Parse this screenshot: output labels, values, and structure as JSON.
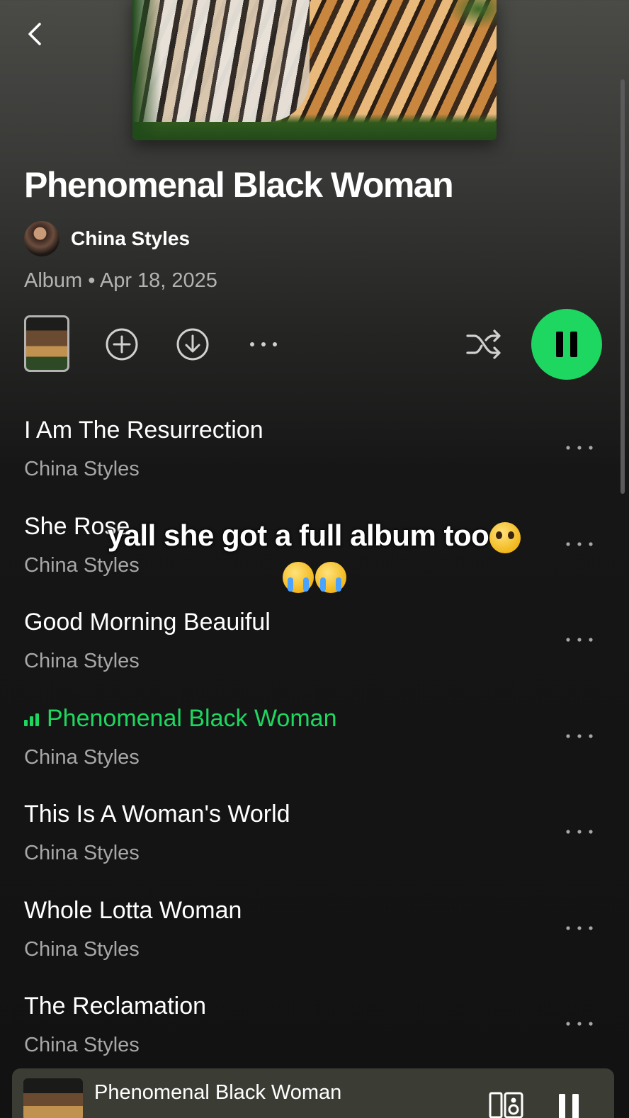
{
  "header": {
    "album_title": "Phenomenal Black Woman",
    "artist": "China Styles",
    "meta": "Album • Apr 18, 2025"
  },
  "colors": {
    "accent": "#1ed760",
    "background": "#121212",
    "secondary_text": "#b3b3b3"
  },
  "icons": {
    "back": "chevron-left-icon",
    "add": "plus-circle-icon",
    "download": "download-icon",
    "more": "more-horizontal-icon",
    "shuffle": "shuffle-icon",
    "pause": "pause-icon",
    "devices": "connect-device-icon"
  },
  "tracks": [
    {
      "title": "I Am The Resurrection",
      "artist": "China Styles"
    },
    {
      "title": "She Rose",
      "artist": "China Styles"
    },
    {
      "title": "Good Morning Beauiful",
      "artist": "China Styles"
    },
    {
      "title": "Phenomenal Black Woman",
      "artist": "China Styles",
      "playing": true
    },
    {
      "title": "This Is A Woman's World",
      "artist": "China Styles"
    },
    {
      "title": "Whole Lotta Woman",
      "artist": "China Styles"
    },
    {
      "title": "The Reclamation",
      "artist": "China Styles"
    }
  ],
  "overlay": {
    "caption": "yall she got a full album too"
  },
  "mini_player": {
    "title": "Phenomenal Black Woman"
  }
}
